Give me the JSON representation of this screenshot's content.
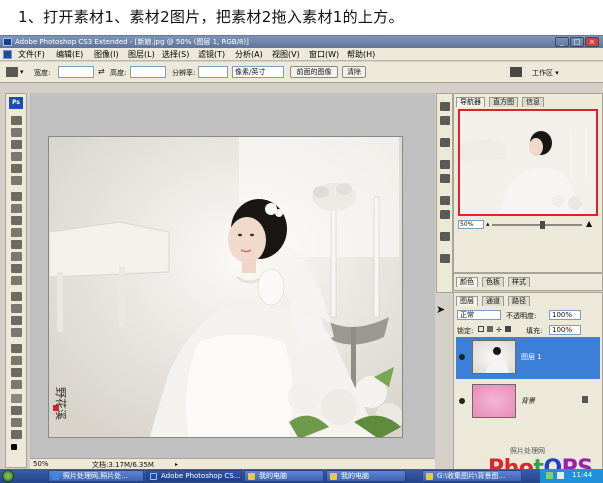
{
  "instruction": "1、打开素材1、素材2图片，把素材2拖入素材1的上方。",
  "window": {
    "title": "Adobe Photoshop CS3 Extended - [新娘.jpg @ 50% (图层 1, RGB/8)]",
    "min": "_",
    "max": "□",
    "close": "×"
  },
  "menu": [
    "文件(F)",
    "编辑(E)",
    "图像(I)",
    "图层(L)",
    "选择(S)",
    "滤镜(T)",
    "分析(A)",
    "视图(V)",
    "窗口(W)",
    "帮助(H)"
  ],
  "options": {
    "width_label": "宽度:",
    "height_label": "高度:",
    "resolution_label": "分辨率:",
    "unit_value": "像素/英寸",
    "front_image_button": "前面的图像",
    "clear_button": "清除",
    "workspace_button": "工作区 ▾"
  },
  "toolbox": {
    "badge": "Ps"
  },
  "status": {
    "zoom": "50%",
    "doc": "文档:3.17M/6.35M"
  },
  "navigator": {
    "tabs": [
      "导航器",
      "直方图",
      "信息"
    ],
    "zoom": "50%"
  },
  "color_panel": {
    "tabs": [
      "颜色",
      "色板",
      "样式"
    ]
  },
  "layers_panel": {
    "tabs": [
      "图层",
      "通道",
      "路径"
    ],
    "blend_mode": "正常",
    "opacity_label": "不透明度:",
    "opacity_value": "100%",
    "lock_label": "锁定:",
    "fill_label": "填充:",
    "fill_value": "100%",
    "layers": [
      {
        "name": "图层 1",
        "selected": true
      },
      {
        "name": "背景",
        "selected": false
      }
    ]
  },
  "canvas": {
    "signature": "野花溪"
  },
  "watermark": {
    "caption": "照片处理网",
    "logo_parts": [
      "Pho",
      "t",
      "O",
      "PS"
    ],
    "colors": {
      "pho": "#e0262d",
      "t": "#22aa44",
      "o": "#2040c8",
      "ps": "#9b1fae"
    }
  },
  "taskbar": {
    "buttons": [
      "照片处理网,照片处...",
      "Adobe Photoshop CS...",
      "我的电脑",
      "我的电脑",
      "G:\\收集图片\\背景图..."
    ],
    "clock": "11:44"
  },
  "colors": {
    "accent_selected_layer": "#3b7fd8",
    "nav_frame": "#e0202a",
    "workspace_bg": "#c0c0c0"
  }
}
